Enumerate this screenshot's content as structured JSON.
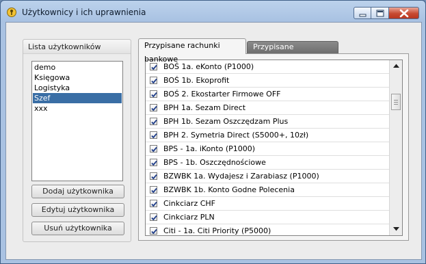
{
  "window": {
    "title": "Użytkownicy i ich uprawnienia"
  },
  "users_panel": {
    "title": "Lista użytkowników",
    "users": [
      "demo",
      "Księgowa",
      "Logistyka",
      "Szef",
      "xxx"
    ],
    "selected": "Szef",
    "buttons": {
      "add": "Dodaj użytkownika",
      "edit": "Edytuj użytkownika",
      "remove": "Usuń użytkownika"
    }
  },
  "tabs": {
    "accounts": "Przypisane rachunki bankowe",
    "permissions": "Przypisane uprawnienia",
    "active": "accounts"
  },
  "accounts": [
    {
      "name": "BOŚ 1a. eKonto (P1000)",
      "checked": true
    },
    {
      "name": "BOŚ 1b. Ekoprofit",
      "checked": true
    },
    {
      "name": "BOŚ 2. Ekostarter Firmowe OFF",
      "checked": true
    },
    {
      "name": "BPH 1a. Sezam Direct",
      "checked": true
    },
    {
      "name": "BPH 1b. Sezam Oszczędzam Plus",
      "checked": true
    },
    {
      "name": "BPH 2. Symetria Direct (S5000+, 10zł)",
      "checked": true
    },
    {
      "name": "BPS - 1a. iKonto (P1000)",
      "checked": true
    },
    {
      "name": "BPS - 1b. Oszczędnościowe",
      "checked": true
    },
    {
      "name": "BZWBK 1a. Wydajesz i Zarabiasz (P1000)",
      "checked": true
    },
    {
      "name": "BZWBK 1b. Konto Godne Polecenia",
      "checked": true
    },
    {
      "name": "Cinkciarz CHF",
      "checked": true
    },
    {
      "name": "Cinkciarz PLN",
      "checked": true
    },
    {
      "name": "Citi - 1a. Citi Priority (P5000)",
      "checked": true
    }
  ],
  "icons": {
    "app": "app-key-icon",
    "minimize": "minimize-icon",
    "maximize": "maximize-icon",
    "close": "close-icon",
    "checkbox": "checkmark-icon",
    "scroll_up": "arrow-up-icon",
    "scroll_down": "arrow-down-icon"
  },
  "colors": {
    "selection": "#3a6ea5",
    "checkmark": "#1f3e8a",
    "close_button": "#c74a32"
  }
}
